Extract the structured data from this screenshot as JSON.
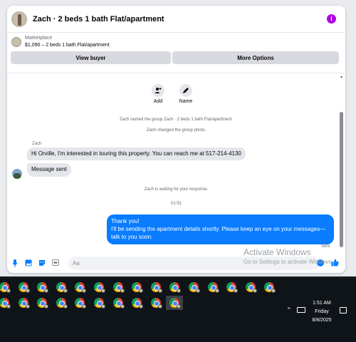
{
  "header": {
    "title": "Zach · 2 beds 1 bath Flat/apartment",
    "info_icon": "i"
  },
  "listing": {
    "label": "Marketplace",
    "price_title": "$1,090 – 2 beds 1 bath Flat/apartment",
    "view_buyer": "View buyer",
    "more_options": "More Options"
  },
  "actions": {
    "add": "Add",
    "name": "Name"
  },
  "messages": {
    "sys_named": "Zach named the group Zach · 2 beds 1 bath Flat/apartment.",
    "sys_photo": "Zach changed the group photo.",
    "sender": "Zach",
    "msg1": "Hi Orville, I'm interested in touring this property. You can reach me at 517-214-4130",
    "msg2": "Message sent",
    "sys_waiting": "Zach is waiting for your response.",
    "time": "01:51",
    "reply_line1": "Thank you!",
    "reply_line2": "I'll be sending the apartment details shortly. Please keep an eye on your messages—talk to you soon.",
    "status": "Sent"
  },
  "composer": {
    "placeholder": "Aa"
  },
  "watermark": {
    "title": "Activate Windows",
    "subtitle": "Go to Settings to activate Windows."
  },
  "taskbar": {
    "time": "1:51 AM",
    "day": "Friday",
    "date": "8/8/2025",
    "icon_names": [
      "chrome-icon",
      "keyboard-icon",
      "notification-icon"
    ]
  },
  "colors": {
    "accent": "#0a7cff",
    "info": "#b100e8",
    "taskbar": "#0f1419"
  }
}
